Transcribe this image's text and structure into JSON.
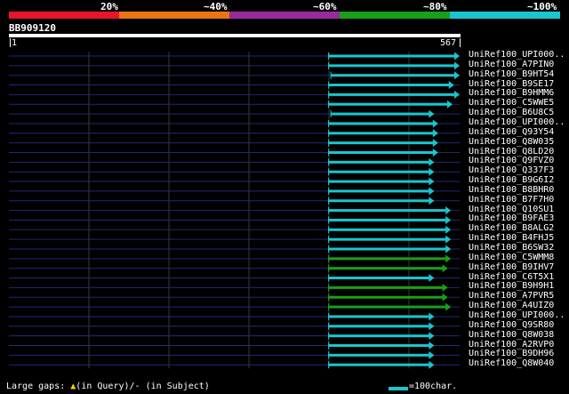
{
  "legend": {
    "colors": [
      "#e8142a",
      "#ea7414",
      "#9a2a9a",
      "#18a018",
      "#19c6cf"
    ],
    "labels": [
      "20%",
      "~40%",
      "~60%",
      "~80%",
      "~100%"
    ]
  },
  "query": {
    "title": "BB909120",
    "start_label": "1",
    "end_label": "567",
    "length": 567
  },
  "grid": {
    "x_positions": [
      100,
      190,
      280,
      370,
      460
    ]
  },
  "hits": [
    {
      "name": "UniRef100_UPI000..",
      "start": 402,
      "end": 567,
      "color": "#19c6cf"
    },
    {
      "name": "UniRef100_A7PIN0",
      "start": 402,
      "end": 567,
      "color": "#19c6cf"
    },
    {
      "name": "UniRef100_B9HT54",
      "start": 405,
      "end": 567,
      "color": "#19c6cf"
    },
    {
      "name": "UniRef100_B9SE17",
      "start": 402,
      "end": 560,
      "color": "#19c6cf"
    },
    {
      "name": "UniRef100_B9HMM6",
      "start": 402,
      "end": 567,
      "color": "#19c6cf"
    },
    {
      "name": "UniRef100_C5WWE5",
      "start": 402,
      "end": 558,
      "color": "#19c6cf"
    },
    {
      "name": "UniRef100_B6U8C5",
      "start": 405,
      "end": 535,
      "color": "#19c6cf"
    },
    {
      "name": "UniRef100_UPI000..",
      "start": 402,
      "end": 540,
      "color": "#19c6cf"
    },
    {
      "name": "UniRef100_Q93Y54",
      "start": 402,
      "end": 540,
      "color": "#19c6cf"
    },
    {
      "name": "UniRef100_Q8W035",
      "start": 402,
      "end": 540,
      "color": "#19c6cf"
    },
    {
      "name": "UniRef100_Q8LD20",
      "start": 402,
      "end": 540,
      "color": "#19c6cf"
    },
    {
      "name": "UniRef100_Q9FVZ0",
      "start": 402,
      "end": 535,
      "color": "#19c6cf"
    },
    {
      "name": "UniRef100_Q337F3",
      "start": 402,
      "end": 535,
      "color": "#19c6cf"
    },
    {
      "name": "UniRef100_B9G6I2",
      "start": 402,
      "end": 535,
      "color": "#19c6cf"
    },
    {
      "name": "UniRef100_B8BHR0",
      "start": 402,
      "end": 535,
      "color": "#19c6cf"
    },
    {
      "name": "UniRef100_B7F7H0",
      "start": 402,
      "end": 535,
      "color": "#19c6cf"
    },
    {
      "name": "UniRef100_Q10SU1",
      "start": 402,
      "end": 556,
      "color": "#19c6cf"
    },
    {
      "name": "UniRef100_B9FAE3",
      "start": 402,
      "end": 556,
      "color": "#19c6cf"
    },
    {
      "name": "UniRef100_B8ALG2",
      "start": 402,
      "end": 556,
      "color": "#19c6cf"
    },
    {
      "name": "UniRef100_B4FHJ5",
      "start": 402,
      "end": 556,
      "color": "#19c6cf"
    },
    {
      "name": "UniRef100_B6SW32",
      "start": 402,
      "end": 556,
      "color": "#19c6cf"
    },
    {
      "name": "UniRef100_C5WMM8",
      "start": 402,
      "end": 556,
      "color": "#18a018"
    },
    {
      "name": "UniRef100_B9IHV7",
      "start": 402,
      "end": 552,
      "color": "#18a018"
    },
    {
      "name": "UniRef100_C6T5X1",
      "start": 402,
      "end": 535,
      "color": "#19c6cf"
    },
    {
      "name": "UniRef100_B9H9H1",
      "start": 402,
      "end": 552,
      "color": "#18a018"
    },
    {
      "name": "UniRef100_A7PVR5",
      "start": 402,
      "end": 552,
      "color": "#18a018"
    },
    {
      "name": "UniRef100_A4UIZ0",
      "start": 402,
      "end": 556,
      "color": "#18a018"
    },
    {
      "name": "UniRef100_UPI000..",
      "start": 402,
      "end": 535,
      "color": "#19c6cf"
    },
    {
      "name": "UniRef100_Q9SR80",
      "start": 402,
      "end": 535,
      "color": "#19c6cf"
    },
    {
      "name": "UniRef100_Q8W038",
      "start": 402,
      "end": 535,
      "color": "#19c6cf"
    },
    {
      "name": "UniRef100_A2RVP0",
      "start": 402,
      "end": 535,
      "color": "#19c6cf"
    },
    {
      "name": "UniRef100_B9DH96",
      "start": 402,
      "end": 535,
      "color": "#19c6cf"
    },
    {
      "name": "UniRef100_Q8W040",
      "start": 402,
      "end": 535,
      "color": "#19c6cf"
    }
  ],
  "footer": {
    "large_gaps_label": "Large gaps:",
    "query_marker": "▲",
    "query_text": "(in Query)/",
    "subject_text": "- (in Subject)",
    "scale_text": "=100char."
  }
}
